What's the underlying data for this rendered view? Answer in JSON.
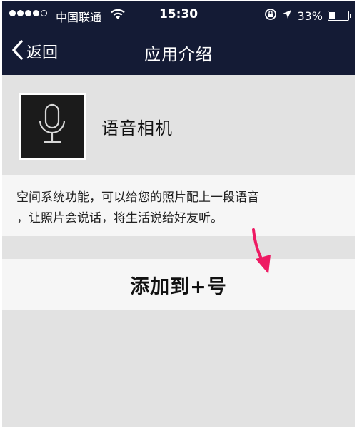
{
  "status_bar": {
    "carrier": "中国联通",
    "time": "15:30",
    "battery_percent": "33%",
    "battery_level": 0.33,
    "signal_icon": "signal-dots-icon",
    "wifi_icon": "wifi-icon",
    "rotation_lock_icon": "rotation-lock-icon",
    "location_icon": "location-arrow-icon"
  },
  "nav": {
    "back_label": "返回",
    "title": "应用介绍"
  },
  "app": {
    "name": "语音相机",
    "icon": "microphone-icon"
  },
  "description": {
    "line1": "空间系统功能，可以给您的照片配上一段语音",
    "line2": "，让照片会说话，将生活说给好友听。"
  },
  "action": {
    "add_label": "添加到+号"
  },
  "colors": {
    "nav_background": "#141b35",
    "page_background": "#e2e2e2",
    "row_background": "#f6f6f6",
    "annotation_arrow": "#ee1a63"
  }
}
